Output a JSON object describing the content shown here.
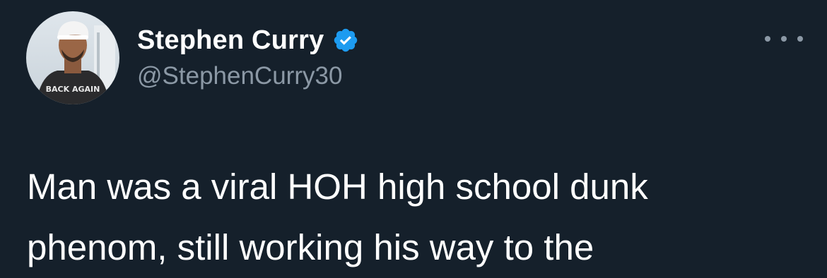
{
  "author": {
    "display_name": "Stephen Curry",
    "handle": "@StephenCurry30",
    "verified": true,
    "avatar_shirt_text": "BACK AGAIN"
  },
  "tweet": {
    "text_lines": [
      "Man was a viral HOH high school dunk",
      "phenom, still working his way to the"
    ]
  },
  "icons": {
    "verified": "verified-badge-icon",
    "more": "more-options-icon"
  },
  "colors": {
    "background": "#15202b",
    "text_primary": "#ffffff",
    "text_secondary": "#8b98a5",
    "verified_blue": "#1d9bf0"
  }
}
